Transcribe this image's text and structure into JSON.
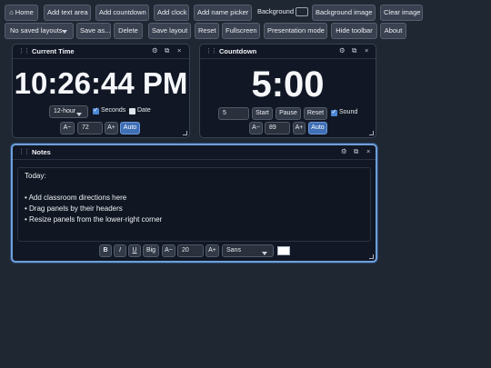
{
  "toolbar": {
    "home": "⌂ Home",
    "add_text_area": "Add text area",
    "add_countdown": "Add countdown",
    "add_clock": "Add clock",
    "add_name_picker": "Add name picker",
    "background_label": "Background",
    "background_image": "Background image",
    "clear_image": "Clear image",
    "layouts_select": "No saved layouts",
    "save_as": "Save as...",
    "delete": "Delete",
    "save_layout": "Save layout",
    "reset": "Reset",
    "fullscreen": "Fullscreen",
    "presentation_mode": "Presentation mode",
    "hide_toolbar": "Hide toolbar",
    "about": "About",
    "background_color": "#1f2733"
  },
  "clock": {
    "title": "Current Time",
    "time": "10:26:44 PM",
    "format": "12-hour",
    "seconds_label": "Seconds",
    "seconds_checked": true,
    "date_label": "Date",
    "date_checked": false,
    "size_down": "A−",
    "size_value": "72",
    "size_up": "A+",
    "auto": "Auto"
  },
  "countdown": {
    "title": "Countdown",
    "display": "5:00",
    "minutes_value": "5",
    "start": "Start",
    "pause": "Pause",
    "reset": "Reset",
    "sound_label": "Sound",
    "sound_checked": true,
    "size_down": "A−",
    "size_value": "89",
    "size_up": "A+",
    "auto": "Auto"
  },
  "notes": {
    "title": "Notes",
    "lines": [
      "Today:",
      "",
      "• Add classroom directions here",
      "• Drag panels by their headers",
      "• Resize panels from the lower-right corner"
    ],
    "bold": "B",
    "italic": "I",
    "underline": "U",
    "big": "Big",
    "size_down": "A−",
    "size_value": "20",
    "size_up": "A+",
    "font": "Sans",
    "text_color": "#ffffff"
  },
  "panel_icons": {
    "grip": "⋮⋮",
    "settings": "⚙",
    "duplicate": "⧉",
    "close": "×"
  }
}
